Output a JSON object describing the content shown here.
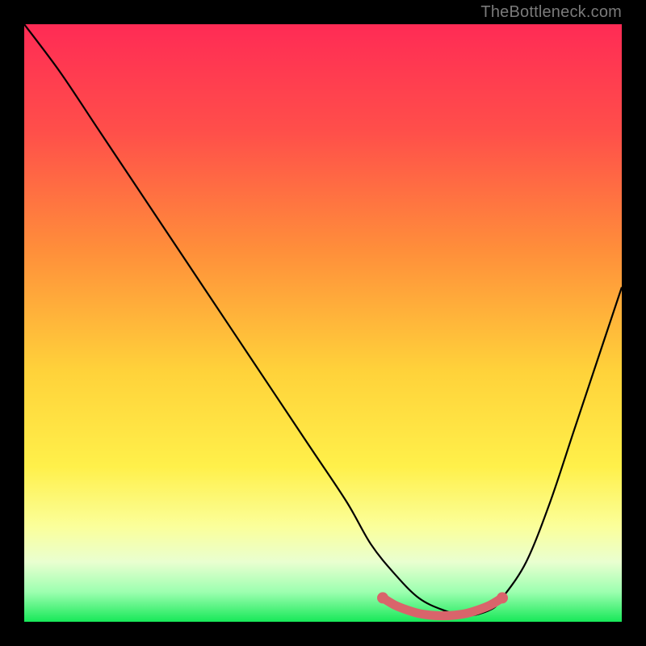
{
  "watermark": "TheBottleneck.com",
  "chart_data": {
    "type": "line",
    "title": "",
    "xlabel": "",
    "ylabel": "",
    "xlim": [
      0,
      100
    ],
    "ylim": [
      0,
      100
    ],
    "grid": false,
    "legend": false,
    "note": "Axes are percentage-of-plot; V-shaped bottleneck curve with flat minimum lobe near the lower right.",
    "gradient_stops": [
      {
        "pct": 0,
        "color": "#ff2b55"
      },
      {
        "pct": 18,
        "color": "#ff4f4a"
      },
      {
        "pct": 38,
        "color": "#ff8f3a"
      },
      {
        "pct": 58,
        "color": "#ffd23a"
      },
      {
        "pct": 74,
        "color": "#fff04a"
      },
      {
        "pct": 84,
        "color": "#fbff9a"
      },
      {
        "pct": 90,
        "color": "#e9ffd0"
      },
      {
        "pct": 95,
        "color": "#9dffb0"
      },
      {
        "pct": 100,
        "color": "#17e858"
      }
    ],
    "series": [
      {
        "name": "bottleneck-curve",
        "color": "#000000",
        "x": [
          0,
          6,
          12,
          18,
          24,
          30,
          36,
          42,
          48,
          54,
          58,
          62,
          66,
          70,
          74,
          78,
          80,
          84,
          88,
          92,
          96,
          100
        ],
        "y": [
          100,
          92,
          83,
          74,
          65,
          56,
          47,
          38,
          29,
          20,
          13,
          8,
          4,
          2,
          1,
          2,
          4,
          10,
          20,
          32,
          44,
          56
        ]
      },
      {
        "name": "min-lobe",
        "color": "#d9646b",
        "x": [
          60,
          62,
          64,
          66,
          68,
          70,
          72,
          74,
          76,
          78,
          80
        ],
        "y": [
          4.0,
          2.8,
          2.0,
          1.4,
          1.1,
          1.0,
          1.1,
          1.4,
          2.0,
          2.8,
          4.0
        ]
      }
    ]
  }
}
